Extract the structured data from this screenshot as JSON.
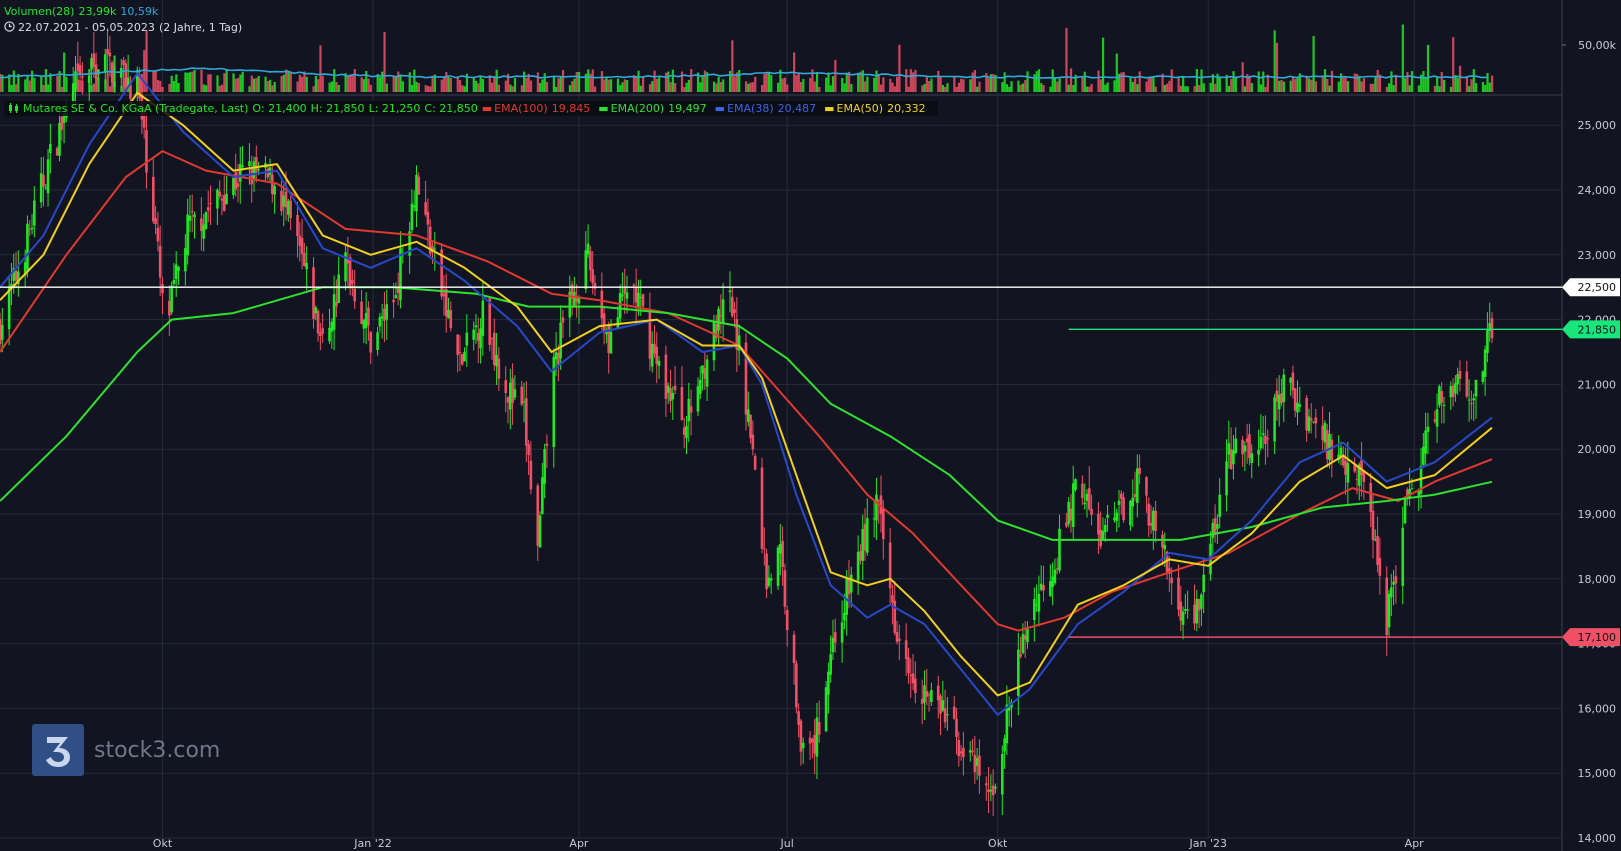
{
  "header": {
    "volume_label": "Volumen(28)",
    "volume_value": "23,99k",
    "volume_avg": "10,59k",
    "period_label": "22.07.2021 - 05.05.2023",
    "period_detail": "(2 Jahre, 1 Tag)"
  },
  "legend": {
    "instrument": "Mutares SE & Co. KGaA (Tradegate, Last)",
    "open": "O: 21,400",
    "high": "H: 21,850",
    "low": "L: 21,250",
    "close": "C: 21,850",
    "ema100_label": "EMA(100)",
    "ema100_value": "19,845",
    "ema200_label": "EMA(200)",
    "ema200_value": "19,497",
    "ema38_label": "EMA(38)",
    "ema38_value": "20,487",
    "ema50_label": "EMA(50)",
    "ema50_value": "20,332"
  },
  "watermark": {
    "text": "stock3.com"
  },
  "colors": {
    "background": "#121521",
    "up": "#22e622",
    "down": "#ef5066",
    "ema100": "#e0392f",
    "ema200": "#2fe02f",
    "ema38": "#2748c8",
    "ema50": "#f1cf1e",
    "volume_avg": "#30a9d6",
    "hline_white": "#ffffff",
    "hline_red": "#ef5066",
    "last_price": "#18e57a"
  },
  "chart_data": {
    "type": "candlestick",
    "title": "Mutares SE & Co. KGaA (Tradegate, Last)",
    "x_range": [
      "2021-07-22",
      "2023-05-05"
    ],
    "x_ticks": [
      {
        "date": "2021-10-01",
        "label": "Okt"
      },
      {
        "date": "2022-01-01",
        "label": "Jan '22"
      },
      {
        "date": "2022-04-01",
        "label": "Apr"
      },
      {
        "date": "2022-07-01",
        "label": "Jul"
      },
      {
        "date": "2022-10-01",
        "label": "Okt"
      },
      {
        "date": "2023-01-01",
        "label": "Jan '23"
      },
      {
        "date": "2023-04-01",
        "label": "Apr"
      }
    ],
    "y_ticks": [
      {
        "value": 14,
        "label": "14,000"
      },
      {
        "value": 15,
        "label": "15,000"
      },
      {
        "value": 16,
        "label": "16,000"
      },
      {
        "value": 17,
        "label": "17,000"
      },
      {
        "value": 18,
        "label": "18,000"
      },
      {
        "value": 19,
        "label": "19,000"
      },
      {
        "value": 20,
        "label": "20,000"
      },
      {
        "value": 21,
        "label": "21,000"
      },
      {
        "value": 22,
        "label": "22,000"
      },
      {
        "value": 23,
        "label": "23,000"
      },
      {
        "value": 24,
        "label": "24,000"
      },
      {
        "value": 25,
        "label": "25,000"
      }
    ],
    "ylim": [
      14,
      25.2
    ],
    "volume_axis": {
      "tick_label": "50,00k",
      "tick_value": 50000
    },
    "price_path": [
      [
        "2021-07-22",
        21.9
      ],
      [
        "2021-08-01",
        23.0
      ],
      [
        "2021-08-12",
        24.4
      ],
      [
        "2021-08-24",
        25.6
      ],
      [
        "2021-09-05",
        26.0
      ],
      [
        "2021-09-20",
        25.6
      ],
      [
        "2021-09-28",
        23.4
      ],
      [
        "2021-10-02",
        21.8
      ],
      [
        "2021-10-12",
        23.4
      ],
      [
        "2021-10-24",
        23.8
      ],
      [
        "2021-11-06",
        24.3
      ],
      [
        "2021-11-20",
        24.1
      ],
      [
        "2021-12-01",
        22.9
      ],
      [
        "2021-12-10",
        21.6
      ],
      [
        "2021-12-20",
        22.9
      ],
      [
        "2021-12-31",
        21.7
      ],
      [
        "2022-01-10",
        22.3
      ],
      [
        "2022-01-20",
        24.2
      ],
      [
        "2022-01-29",
        22.7
      ],
      [
        "2022-02-08",
        21.3
      ],
      [
        "2022-02-18",
        22.1
      ],
      [
        "2022-03-01",
        20.9
      ],
      [
        "2022-03-08",
        20.5
      ],
      [
        "2022-03-14",
        18.4
      ],
      [
        "2022-03-20",
        21.1
      ],
      [
        "2022-03-28",
        22.3
      ],
      [
        "2022-04-05",
        22.9
      ],
      [
        "2022-04-14",
        21.7
      ],
      [
        "2022-04-24",
        22.6
      ],
      [
        "2022-05-06",
        21.2
      ],
      [
        "2022-05-18",
        20.4
      ],
      [
        "2022-05-28",
        21.6
      ],
      [
        "2022-06-06",
        22.3
      ],
      [
        "2022-06-12",
        21.1
      ],
      [
        "2022-06-17",
        19.6
      ],
      [
        "2022-06-22",
        18.0
      ],
      [
        "2022-06-28",
        18.4
      ],
      [
        "2022-07-03",
        16.8
      ],
      [
        "2022-07-09",
        15.0
      ],
      [
        "2022-07-14",
        15.6
      ],
      [
        "2022-07-20",
        16.9
      ],
      [
        "2022-07-30",
        18.1
      ],
      [
        "2022-08-09",
        19.2
      ],
      [
        "2022-08-17",
        17.4
      ],
      [
        "2022-08-27",
        16.4
      ],
      [
        "2022-09-08",
        15.9
      ],
      [
        "2022-09-20",
        15.1
      ],
      [
        "2022-09-28",
        14.6
      ],
      [
        "2022-10-06",
        16.0
      ],
      [
        "2022-10-15",
        17.5
      ],
      [
        "2022-10-26",
        18.3
      ],
      [
        "2022-11-06",
        19.6
      ],
      [
        "2022-11-13",
        18.6
      ],
      [
        "2022-11-22",
        18.9
      ],
      [
        "2022-12-01",
        19.6
      ],
      [
        "2022-12-10",
        18.6
      ],
      [
        "2022-12-18",
        17.7
      ],
      [
        "2022-12-25",
        17.3
      ],
      [
        "2023-01-01",
        18.3
      ],
      [
        "2023-01-10",
        19.9
      ],
      [
        "2023-01-24",
        20.0
      ],
      [
        "2023-02-03",
        21.0
      ],
      [
        "2023-02-14",
        20.5
      ],
      [
        "2023-02-24",
        20.0
      ],
      [
        "2023-03-08",
        19.7
      ],
      [
        "2023-03-15",
        18.6
      ],
      [
        "2023-03-20",
        17.4
      ],
      [
        "2023-03-28",
        19.0
      ],
      [
        "2023-04-04",
        19.7
      ],
      [
        "2023-04-10",
        20.7
      ],
      [
        "2023-04-20",
        21.1
      ],
      [
        "2023-04-28",
        20.9
      ],
      [
        "2023-05-05",
        21.85
      ]
    ],
    "series": [
      {
        "name": "EMA(100)",
        "path": [
          [
            "2021-07-22",
            21.5
          ],
          [
            "2021-08-20",
            23.0
          ],
          [
            "2021-09-15",
            24.2
          ],
          [
            "2021-10-01",
            24.6
          ],
          [
            "2021-10-20",
            24.3
          ],
          [
            "2021-11-20",
            24.1
          ],
          [
            "2021-12-20",
            23.4
          ],
          [
            "2022-01-20",
            23.3
          ],
          [
            "2022-02-20",
            22.9
          ],
          [
            "2022-03-20",
            22.4
          ],
          [
            "2022-04-10",
            22.3
          ],
          [
            "2022-05-10",
            22.1
          ],
          [
            "2022-06-10",
            21.6
          ],
          [
            "2022-06-25",
            21.0
          ],
          [
            "2022-07-15",
            20.2
          ],
          [
            "2022-08-05",
            19.3
          ],
          [
            "2022-08-25",
            18.7
          ],
          [
            "2022-09-15",
            17.9
          ],
          [
            "2022-10-01",
            17.3
          ],
          [
            "2022-10-10",
            17.2
          ],
          [
            "2022-10-30",
            17.4
          ],
          [
            "2022-11-20",
            17.8
          ],
          [
            "2022-12-15",
            18.1
          ],
          [
            "2023-01-10",
            18.4
          ],
          [
            "2023-02-10",
            19.0
          ],
          [
            "2023-03-05",
            19.4
          ],
          [
            "2023-03-25",
            19.2
          ],
          [
            "2023-04-10",
            19.5
          ],
          [
            "2023-05-05",
            19.845
          ]
        ]
      },
      {
        "name": "EMA(200)",
        "path": [
          [
            "2021-07-22",
            19.2
          ],
          [
            "2021-08-20",
            20.2
          ],
          [
            "2021-09-20",
            21.5
          ],
          [
            "2021-10-05",
            22.0
          ],
          [
            "2021-11-01",
            22.1
          ],
          [
            "2021-12-10",
            22.5
          ],
          [
            "2022-01-10",
            22.5
          ],
          [
            "2022-02-15",
            22.4
          ],
          [
            "2022-03-10",
            22.2
          ],
          [
            "2022-04-10",
            22.2
          ],
          [
            "2022-05-10",
            22.1
          ],
          [
            "2022-06-10",
            21.9
          ],
          [
            "2022-07-01",
            21.4
          ],
          [
            "2022-07-20",
            20.7
          ],
          [
            "2022-08-15",
            20.2
          ],
          [
            "2022-09-10",
            19.6
          ],
          [
            "2022-10-01",
            18.9
          ],
          [
            "2022-10-25",
            18.6
          ],
          [
            "2022-11-20",
            18.6
          ],
          [
            "2022-12-20",
            18.6
          ],
          [
            "2023-01-20",
            18.8
          ],
          [
            "2023-02-20",
            19.1
          ],
          [
            "2023-03-20",
            19.2
          ],
          [
            "2023-04-10",
            19.3
          ],
          [
            "2023-05-05",
            19.497
          ]
        ]
      },
      {
        "name": "EMA(38)",
        "path": [
          [
            "2021-07-22",
            22.5
          ],
          [
            "2021-08-10",
            23.3
          ],
          [
            "2021-08-30",
            24.7
          ],
          [
            "2021-09-20",
            25.8
          ],
          [
            "2021-10-10",
            24.9
          ],
          [
            "2021-11-01",
            24.2
          ],
          [
            "2021-11-20",
            24.3
          ],
          [
            "2021-12-10",
            23.1
          ],
          [
            "2021-12-31",
            22.8
          ],
          [
            "2022-01-20",
            23.1
          ],
          [
            "2022-02-10",
            22.6
          ],
          [
            "2022-03-05",
            21.9
          ],
          [
            "2022-03-20",
            21.2
          ],
          [
            "2022-04-10",
            21.8
          ],
          [
            "2022-05-05",
            22.0
          ],
          [
            "2022-05-25",
            21.5
          ],
          [
            "2022-06-10",
            21.6
          ],
          [
            "2022-06-20",
            21.0
          ],
          [
            "2022-07-05",
            19.3
          ],
          [
            "2022-07-20",
            17.9
          ],
          [
            "2022-08-05",
            17.4
          ],
          [
            "2022-08-15",
            17.6
          ],
          [
            "2022-08-30",
            17.3
          ],
          [
            "2022-09-15",
            16.6
          ],
          [
            "2022-10-01",
            15.9
          ],
          [
            "2022-10-15",
            16.3
          ],
          [
            "2022-11-05",
            17.3
          ],
          [
            "2022-11-25",
            17.8
          ],
          [
            "2022-12-15",
            18.4
          ],
          [
            "2023-01-01",
            18.3
          ],
          [
            "2023-01-20",
            18.9
          ],
          [
            "2023-02-10",
            19.8
          ],
          [
            "2023-03-01",
            20.1
          ],
          [
            "2023-03-20",
            19.5
          ],
          [
            "2023-04-10",
            19.8
          ],
          [
            "2023-05-05",
            20.487
          ]
        ]
      },
      {
        "name": "EMA(50)",
        "path": [
          [
            "2021-07-22",
            22.3
          ],
          [
            "2021-08-10",
            23.0
          ],
          [
            "2021-08-30",
            24.4
          ],
          [
            "2021-09-20",
            25.5
          ],
          [
            "2021-10-10",
            25.0
          ],
          [
            "2021-11-01",
            24.3
          ],
          [
            "2021-11-20",
            24.4
          ],
          [
            "2021-12-10",
            23.3
          ],
          [
            "2021-12-31",
            23.0
          ],
          [
            "2022-01-20",
            23.2
          ],
          [
            "2022-02-10",
            22.8
          ],
          [
            "2022-03-05",
            22.2
          ],
          [
            "2022-03-20",
            21.5
          ],
          [
            "2022-04-10",
            21.9
          ],
          [
            "2022-05-05",
            22.0
          ],
          [
            "2022-05-25",
            21.6
          ],
          [
            "2022-06-10",
            21.6
          ],
          [
            "2022-06-20",
            21.1
          ],
          [
            "2022-07-05",
            19.6
          ],
          [
            "2022-07-20",
            18.1
          ],
          [
            "2022-08-05",
            17.9
          ],
          [
            "2022-08-15",
            18.0
          ],
          [
            "2022-08-30",
            17.5
          ],
          [
            "2022-09-15",
            16.8
          ],
          [
            "2022-10-01",
            16.2
          ],
          [
            "2022-10-15",
            16.4
          ],
          [
            "2022-11-05",
            17.6
          ],
          [
            "2022-11-25",
            17.9
          ],
          [
            "2022-12-15",
            18.3
          ],
          [
            "2023-01-01",
            18.2
          ],
          [
            "2023-01-20",
            18.7
          ],
          [
            "2023-02-10",
            19.5
          ],
          [
            "2023-03-01",
            19.9
          ],
          [
            "2023-03-20",
            19.4
          ],
          [
            "2023-04-10",
            19.6
          ],
          [
            "2023-05-05",
            20.332
          ]
        ]
      }
    ],
    "horizontal_lines": [
      {
        "value": 22.5,
        "label": "22,500",
        "color": "#ffffff",
        "from": "2021-07-22"
      },
      {
        "value": 21.85,
        "label": "21,850",
        "color": "#18e57a",
        "from": "2022-11-01"
      },
      {
        "value": 17.1,
        "label": "17,100",
        "color": "#ef5066",
        "from": "2022-11-01"
      }
    ]
  }
}
